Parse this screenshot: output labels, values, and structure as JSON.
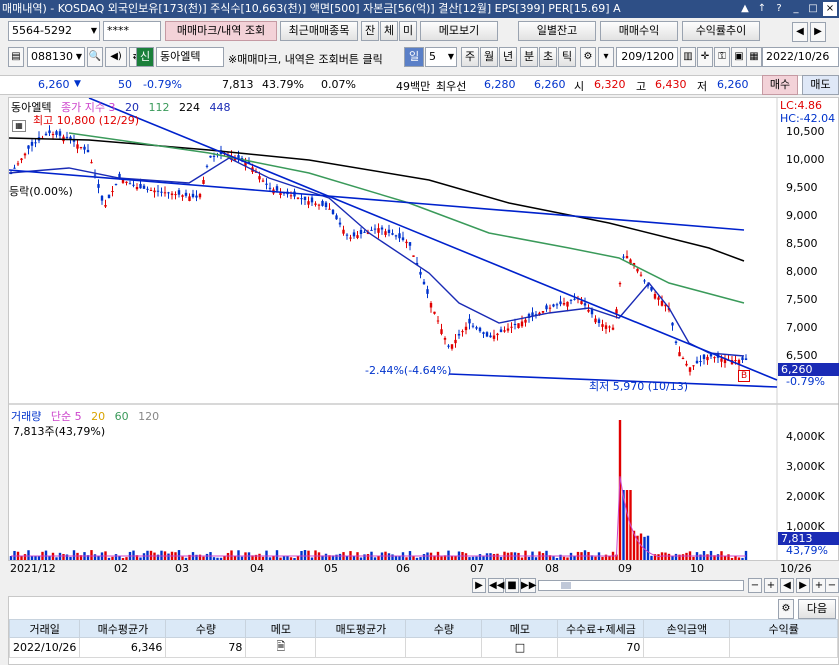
{
  "titlebar": {
    "title": "매매내역) - KOSDAQ 외국인보유[173(천)] 주식수[10,663(천)] 액면[500] 자본금[56(억)] 결산[12월] EPS[399] PER[15.69] A",
    "controls": [
      "▲",
      "↑",
      "?",
      "_",
      "□",
      "×"
    ]
  },
  "row1": {
    "account": "5564-5292",
    "password": "****",
    "btn_trade_view": "매매마크/내역 조회",
    "btn_recent": "최근매매종목",
    "btn_jan": "잔",
    "btn_che": "체",
    "btn_mi": "미",
    "btn_memo": "메모보기",
    "btn_daily": "일별잔고",
    "btn_profit": "매매수익",
    "btn_trend": "수익률추이"
  },
  "row2": {
    "code": "088130",
    "sin": "신",
    "name": "동아엘텍",
    "notice": "※매매마크, 내역은 조회버튼 클릭",
    "period_day": "일",
    "period_num": "5",
    "periods": [
      "주",
      "월",
      "년",
      "분",
      "초",
      "틱"
    ],
    "count": "209",
    "count_total": "/1200",
    "date": "2022/10/26"
  },
  "row3": {
    "price": "6,260",
    "change": "50",
    "change_pct": "-0.79%",
    "volume": "7,813",
    "vol_ratio": "43.79%",
    "turnover": "0.07%",
    "amount": "49백만",
    "best_sell_label": "최우선",
    "best_sell": "6,280",
    "best_buy": "6,260",
    "open_label": "시",
    "open": "6,320",
    "high_label": "고",
    "high": "6,430",
    "low_label": "저",
    "low": "6,260",
    "btn_buy": "매수",
    "btn_sell": "매도"
  },
  "price_pane": {
    "legend_name": "동아엘텍",
    "legend_series": "종가 지수 3",
    "ma": [
      "20",
      "112",
      "224",
      "448"
    ],
    "lc": "LC:4.86",
    "hc": "HC:-42.04",
    "high_annot": "최고 10,800 (12/29)",
    "low_annot": "최저 5,970 (10/13)",
    "left_annot": "등락(0.00%)",
    "mid_annot": "-2.44%(-4.64%)",
    "y_ticks": [
      "10,500",
      "10,000",
      "9,500",
      "9,000",
      "8,500",
      "8,000",
      "7,500",
      "7,000",
      "6,500"
    ],
    "cur_price": "6,260",
    "cur_pct": "-0.79%",
    "mark_b": "B"
  },
  "volume_pane": {
    "legend_name": "거래량",
    "legend_series": "단순 5",
    "ma": [
      "20",
      "60",
      "120"
    ],
    "vol_label": "7,813주(43,79%)",
    "y_ticks": [
      "4,000K",
      "3,000K",
      "2,000K",
      "1,000K"
    ],
    "cur_vol": "7,813",
    "cur_pct": "43,79%"
  },
  "x_axis": {
    "labels": [
      "2021/12",
      "02",
      "03",
      "04",
      "05",
      "06",
      "07",
      "08",
      "09",
      "10",
      "10/26"
    ]
  },
  "bottom": {
    "btn_next": "다음",
    "headers": [
      "거래일",
      "매수평균가",
      "수량",
      "메모",
      "매도평균가",
      "수량",
      "메모",
      "수수료+제세금",
      "손익금액",
      "수익률"
    ],
    "rows": [
      {
        "date": "2022/10/26",
        "buy_avg": "6,346",
        "qty": "78",
        "sell_avg": "",
        "sell_qty": "",
        "fee": "70",
        "pnl": "",
        "rate": ""
      }
    ]
  },
  "colors": {
    "up": "#e00000",
    "down": "#0033cc",
    "ma20": "#1a2bb5",
    "ma112": "#3a9a5a",
    "ma224": "#000000"
  }
}
